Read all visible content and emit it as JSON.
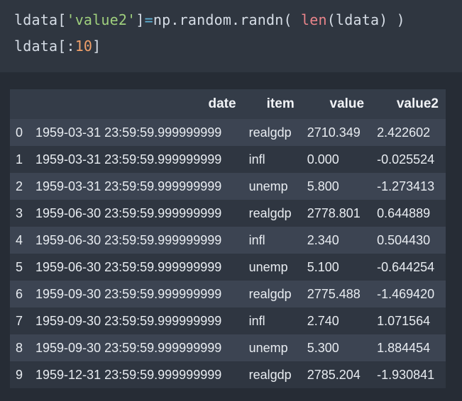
{
  "code": {
    "line1": {
      "a": "ldata[",
      "b": "'value2'",
      "c": "]",
      "d": "=",
      "e": "np.random.randn( ",
      "f": "len",
      "g": "(ldata) )"
    },
    "line2": {
      "a": "ldata[:",
      "b": "10",
      "c": "]"
    }
  },
  "table": {
    "columns": [
      "",
      "date",
      "item",
      "value",
      "value2"
    ],
    "rows": [
      {
        "idx": "0",
        "date": "1959-03-31 23:59:59.999999999",
        "item": "realgdp",
        "value": "2710.349",
        "value2": "2.422602"
      },
      {
        "idx": "1",
        "date": "1959-03-31 23:59:59.999999999",
        "item": "infl",
        "value": "0.000",
        "value2": "-0.025524"
      },
      {
        "idx": "2",
        "date": "1959-03-31 23:59:59.999999999",
        "item": "unemp",
        "value": "5.800",
        "value2": "-1.273413"
      },
      {
        "idx": "3",
        "date": "1959-06-30 23:59:59.999999999",
        "item": "realgdp",
        "value": "2778.801",
        "value2": "0.644889"
      },
      {
        "idx": "4",
        "date": "1959-06-30 23:59:59.999999999",
        "item": "infl",
        "value": "2.340",
        "value2": "0.504430"
      },
      {
        "idx": "5",
        "date": "1959-06-30 23:59:59.999999999",
        "item": "unemp",
        "value": "5.100",
        "value2": "-0.644254"
      },
      {
        "idx": "6",
        "date": "1959-09-30 23:59:59.999999999",
        "item": "realgdp",
        "value": "2775.488",
        "value2": "-1.469420"
      },
      {
        "idx": "7",
        "date": "1959-09-30 23:59:59.999999999",
        "item": "infl",
        "value": "2.740",
        "value2": "1.071564"
      },
      {
        "idx": "8",
        "date": "1959-09-30 23:59:59.999999999",
        "item": "unemp",
        "value": "5.300",
        "value2": "1.884454"
      },
      {
        "idx": "9",
        "date": "1959-12-31 23:59:59.999999999",
        "item": "realgdp",
        "value": "2785.204",
        "value2": "-1.930841"
      }
    ]
  }
}
